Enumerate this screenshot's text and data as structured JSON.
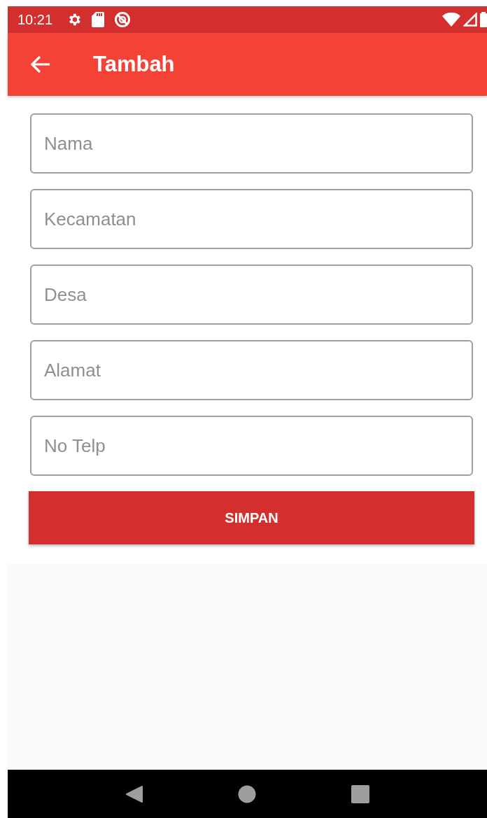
{
  "status_bar": {
    "time": "10:21"
  },
  "app_bar": {
    "title": "Tambah"
  },
  "fields": [
    {
      "placeholder": "Nama"
    },
    {
      "placeholder": "Kecamatan"
    },
    {
      "placeholder": "Desa"
    },
    {
      "placeholder": "Alamat"
    },
    {
      "placeholder": "No Telp"
    }
  ],
  "save_button": {
    "label": "SIMPAN"
  }
}
